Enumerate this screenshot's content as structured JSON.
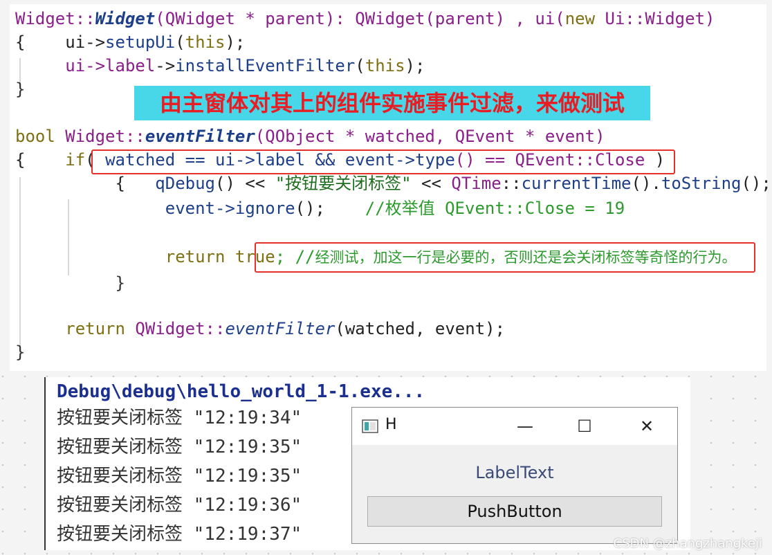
{
  "code": {
    "l1": [
      "Widget::",
      "Widget",
      "(QWidget * parent): QWidget(parent) , ui(",
      "new",
      " Ui::Widget)"
    ],
    "l2": [
      "{    ui->",
      "setupUi",
      "(",
      "this",
      ");"
    ],
    "l3": [
      "     ui->",
      "label",
      "->",
      "installEventFilter",
      "(",
      "this",
      ");"
    ],
    "l4": "}",
    "l5": [
      "bool",
      " Widget::",
      "eventFilter",
      "(QObject * watched, QEvent * event)"
    ],
    "l6": [
      "{    ",
      "if",
      "( ",
      "watched == ui->label && event->",
      "type",
      "() == QEvent::Close",
      " )"
    ],
    "l7": [
      "          {   ",
      "qDebug",
      "() << ",
      "\"按钮要关闭标签\"",
      " << ",
      "QTime",
      "::",
      "currentTime",
      "().",
      "toString",
      "();"
    ],
    "l8": [
      "               event->",
      "ignore",
      "();    ",
      "//枚举值 QEvent::Close = 19"
    ],
    "l9": [
      "               ",
      "return",
      " ",
      "true",
      "; //",
      "经测试，加这一行是必要的，否则还是会关闭标签等奇怪的行为。"
    ],
    "l10": "          }",
    "l11": [
      "     ",
      "return",
      " QWidget::",
      "eventFilter",
      "(watched, event);"
    ],
    "l12": "}"
  },
  "annotation": "由主窗体对其上的组件实施事件过滤，来做测试",
  "console": {
    "header": "Debug\\debug\\hello_world_1-1.exe...",
    "lines": [
      "按钮要关闭标签 \"12:19:34\"",
      "按钮要关闭标签 \"12:19:35\"",
      "按钮要关闭标签 \"12:19:35\"",
      "按钮要关闭标签 \"12:19:36\"",
      "按钮要关闭标签 \"12:19:37\""
    ]
  },
  "window": {
    "title": "H",
    "minimize": "—",
    "maximize": "☐",
    "close": "✕",
    "label": "LabelText",
    "button": "PushButton"
  },
  "watermark": "CSDN @zhangzhangkeji",
  "colors": {
    "annotation_bg": "#48d7e8",
    "annotation_text": "#e81c22",
    "highlight_box": "#e5302a"
  }
}
